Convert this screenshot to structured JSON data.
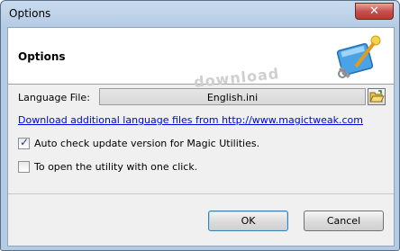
{
  "window": {
    "title": "Options",
    "close_label": "✕"
  },
  "header": {
    "title": "Options",
    "icon": "magic-tools-icon"
  },
  "watermark": "download",
  "language": {
    "label": "Language File:",
    "value": "English.ini",
    "browse_icon": "folder-open-icon"
  },
  "link_text": "Download additional language files from http://www.magictweak.com",
  "options": [
    {
      "label": "Auto check update version for Magic Utilities.",
      "checked": true
    },
    {
      "label": "To open the utility with one click.",
      "checked": false
    }
  ],
  "buttons": {
    "ok": "OK",
    "cancel": "Cancel"
  },
  "colors": {
    "link": "#0000ee",
    "close_button": "#c75050",
    "title_bar": "#b9cfe7"
  }
}
